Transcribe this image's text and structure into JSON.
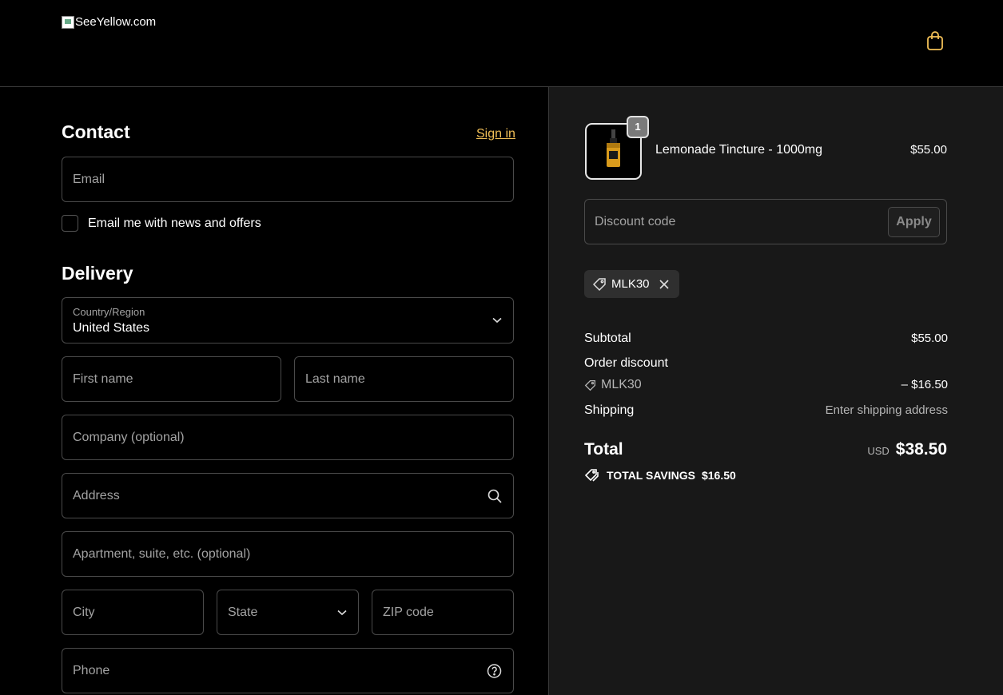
{
  "header": {
    "logo_alt": "SeeYellow.com",
    "cart_icon": "shopping-bag-icon"
  },
  "contact": {
    "title": "Contact",
    "signin": "Sign in",
    "email_placeholder": "Email",
    "newsletter_label": "Email me with news and offers"
  },
  "delivery": {
    "title": "Delivery",
    "country_label": "Country/Region",
    "country_value": "United States",
    "first_name": "First name",
    "last_name": "Last name",
    "company": "Company (optional)",
    "address": "Address",
    "apartment": "Apartment, suite, etc. (optional)",
    "city": "City",
    "state": "State",
    "zip": "ZIP code",
    "phone": "Phone"
  },
  "summary": {
    "item": {
      "quantity": "1",
      "name": "Lemonade Tincture - 1000mg",
      "price": "$55.00"
    },
    "discount_placeholder": "Discount code",
    "apply_label": "Apply",
    "applied_code": "MLK30",
    "subtotal_label": "Subtotal",
    "subtotal_value": "$55.00",
    "order_discount_label": "Order discount",
    "discount_code": "MLK30",
    "discount_value": "– $16.50",
    "shipping_label": "Shipping",
    "shipping_value": "Enter shipping address",
    "total_label": "Total",
    "currency": "USD",
    "total_value": "$38.50",
    "savings_label": "TOTAL SAVINGS",
    "savings_value": "$16.50"
  },
  "colors": {
    "accent": "#f2c057",
    "background": "#000000",
    "summary_background": "#181818"
  }
}
